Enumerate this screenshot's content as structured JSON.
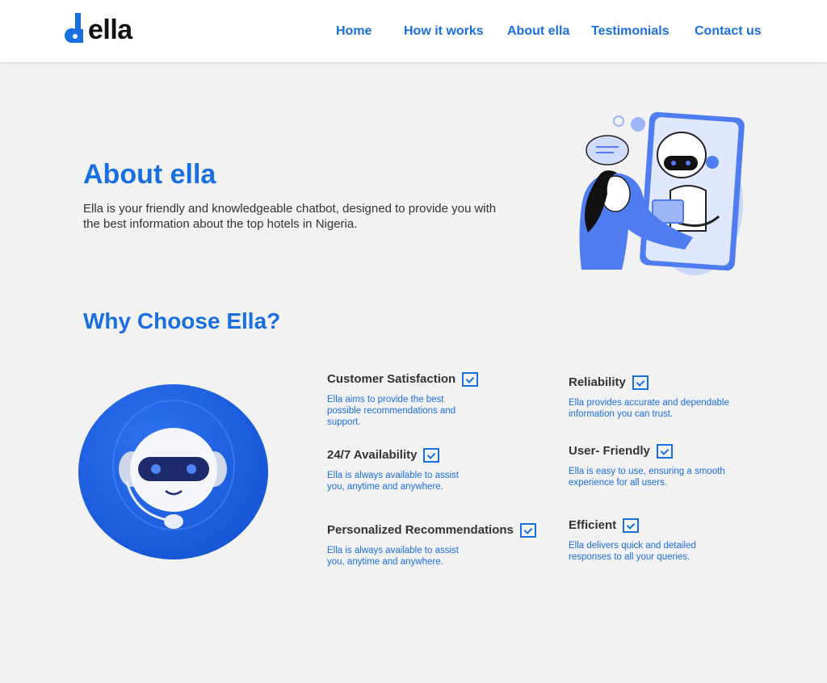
{
  "header": {
    "logo_text": "ella",
    "nav": [
      "Home",
      "How it works",
      "About ella",
      "Testimonials",
      "Contact us"
    ]
  },
  "about": {
    "title": "About ella",
    "text": "Ella is your friendly and knowledgeable chatbot, designed to provide you with the best information about the top hotels in Nigeria."
  },
  "why": {
    "title": "Why Choose Ella?",
    "features": [
      {
        "title": "Customer Satisfaction",
        "desc": "Ella aims to provide the best possible recommendations and support."
      },
      {
        "title": "24/7 Availability",
        "desc": "Ella is always available to assist you, anytime and anywhere."
      },
      {
        "title": "Personalized Recommendations",
        "desc": "Ella is always available to assist you, anytime and anywhere."
      },
      {
        "title": "Reliability",
        "desc": "Ella provides accurate and dependable information you can trust."
      },
      {
        "title": "User- Friendly",
        "desc": "Ella is easy to use, ensuring a smooth experience for all users."
      },
      {
        "title": "Efficient",
        "desc": "Ella delivers quick and detailed responses to all your queries."
      }
    ]
  },
  "colors": {
    "accent": "#1a6fe0",
    "background": "#f2f2f2"
  }
}
